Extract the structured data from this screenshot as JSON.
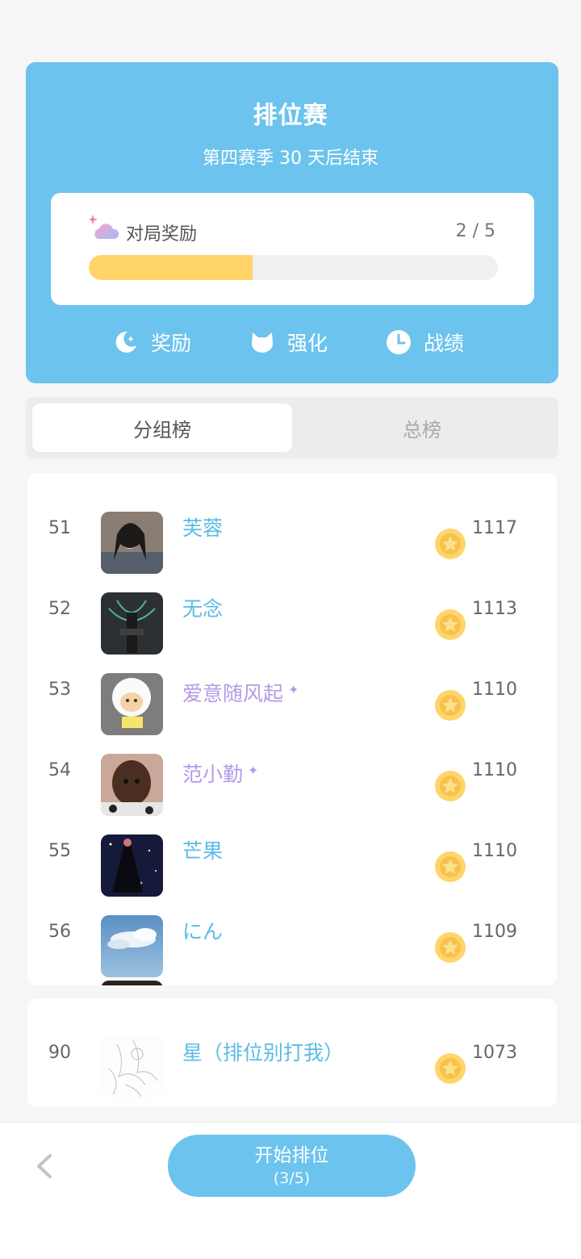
{
  "header": {
    "title": "排位赛",
    "subtitle": "第四赛季 30 天后结束"
  },
  "match_reward": {
    "label": "对局奖励",
    "progress_text": "2 / 5",
    "progress_fraction": 0.4
  },
  "quick_links": [
    {
      "label": "奖励",
      "icon": "moon-star-icon"
    },
    {
      "label": "强化",
      "icon": "cat-icon"
    },
    {
      "label": "战绩",
      "icon": "clock-icon"
    }
  ],
  "tabs": [
    {
      "label": "分组榜",
      "active": true
    },
    {
      "label": "总榜",
      "active": false
    }
  ],
  "leaderboard": [
    {
      "rank": "51",
      "name": "芙蓉",
      "score": "1117",
      "highlight": false
    },
    {
      "rank": "52",
      "name": "无念",
      "score": "1113",
      "highlight": false
    },
    {
      "rank": "53",
      "name": "爱意随风起",
      "score": "1110",
      "highlight": true
    },
    {
      "rank": "54",
      "name": "范小勤",
      "score": "1110",
      "highlight": true
    },
    {
      "rank": "55",
      "name": "芒果",
      "score": "1110",
      "highlight": false
    },
    {
      "rank": "56",
      "name": "にん",
      "score": "1109",
      "highlight": false
    }
  ],
  "my_entry": {
    "rank": "90",
    "name": "星（排位别打我）",
    "score": "1073"
  },
  "bottom": {
    "start_label": "开始排位",
    "start_count": "(3/5)"
  },
  "colors": {
    "accent": "#6cc3ed",
    "progress": "#ffd56a",
    "name_blue": "#5cbbe6",
    "name_purple": "#b59ae8",
    "coin": "#ffd56a"
  }
}
